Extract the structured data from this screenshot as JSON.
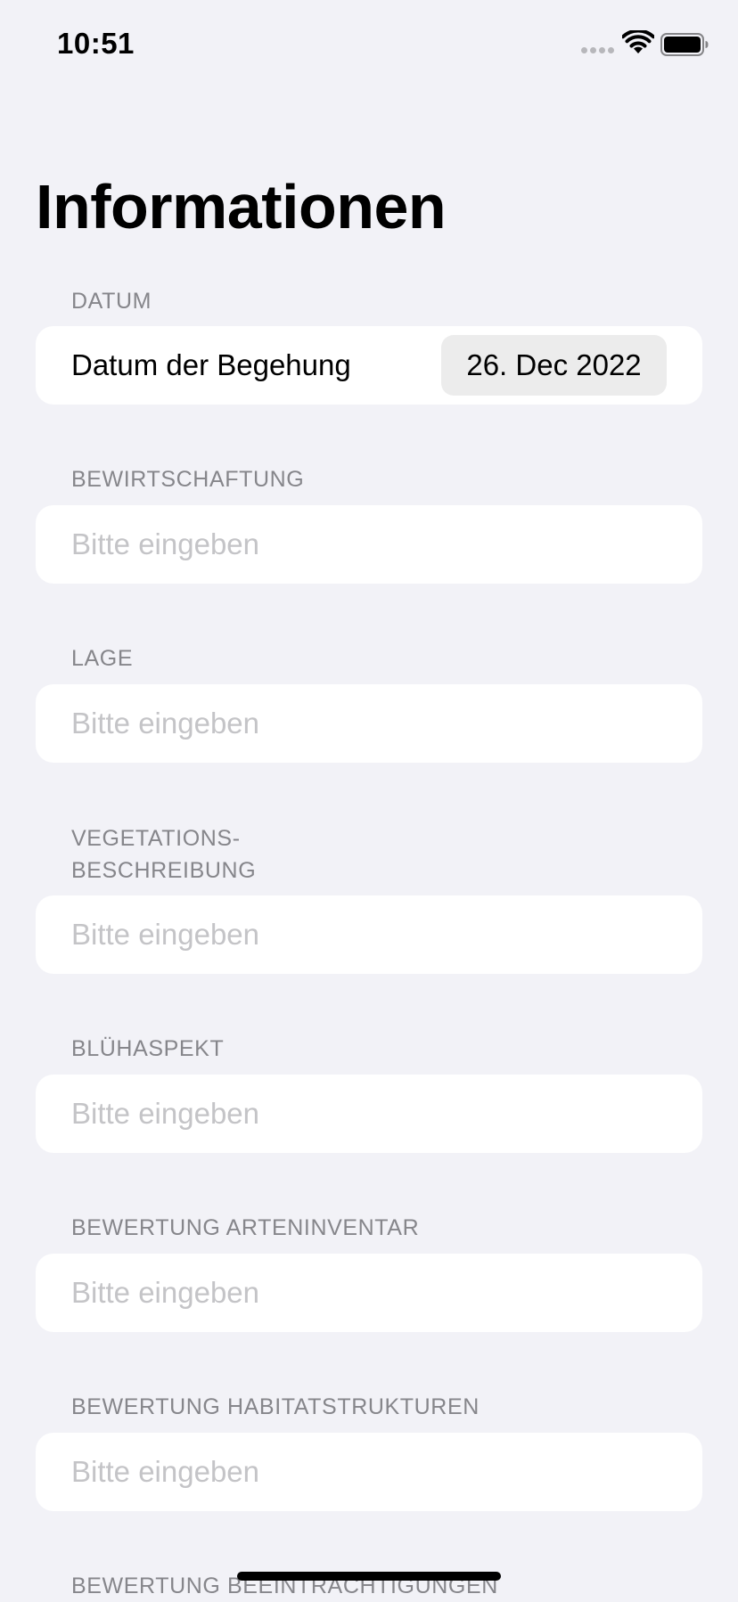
{
  "status_bar": {
    "time": "10:51"
  },
  "title": "Informationen",
  "date_section": {
    "header": "DATUM",
    "label": "Datum der Begehung",
    "value": "26. Dec 2022"
  },
  "fields": [
    {
      "header": "BEWIRTSCHAFTUNG",
      "value": "",
      "placeholder": "Bitte eingeben"
    },
    {
      "header": "LAGE",
      "value": "",
      "placeholder": "Bitte eingeben"
    },
    {
      "header_line1": "VEGETATIONS-",
      "header_line2": "BESCHREIBUNG",
      "value": "",
      "placeholder": "Bitte eingeben"
    },
    {
      "header": "BLÜHASPEKT",
      "value": "",
      "placeholder": "Bitte eingeben"
    },
    {
      "header": "BEWERTUNG ARTENINVENTAR",
      "value": "",
      "placeholder": "Bitte eingeben"
    },
    {
      "header": "BEWERTUNG HABITATSTRUKTUREN",
      "value": "",
      "placeholder": "Bitte eingeben"
    },
    {
      "header": "BEWERTUNG BEEINTRÄCHTIGUNGEN"
    }
  ],
  "icons": {
    "signal": "cellular-signal-icon",
    "wifi": "wifi-icon",
    "battery": "battery-icon"
  },
  "colors": {
    "background": "#f2f2f7",
    "card": "#ffffff",
    "section_header": "#86868b",
    "placeholder": "#c4c4c7",
    "date_pill": "#ececec"
  }
}
